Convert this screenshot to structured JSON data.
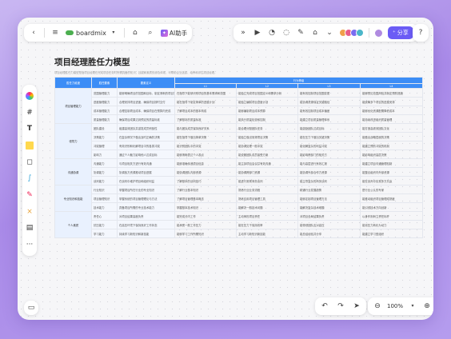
{
  "top_bar": {
    "back_icon": "chevron-left-icon",
    "menu_icon": "menu-icon",
    "app_name": "boardmix",
    "tag_icon": "tag-icon",
    "search_icon": "search-icon",
    "ai_label": "AI助手"
  },
  "toolbar_mid": {
    "icons": [
      "expand-icon",
      "play-icon",
      "timer-icon",
      "comment-icon",
      "vote-icon",
      "library-icon",
      "more-icon"
    ],
    "share_label": "分享"
  },
  "sidebar": {
    "tools": [
      "logo-icon",
      "frame-icon",
      "text-icon",
      "sticky-note-icon",
      "shape-icon",
      "connector-icon",
      "pen-icon",
      "mindmap-icon",
      "template-icon",
      "more-icon"
    ]
  },
  "bottom": {
    "zoom_level": "100%"
  },
  "document": {
    "title": "项目经理胜任力模型",
    "description": "项目经理胜任力模型是指项目经理在完成项目任务时所需具备的知识、技能和素质的综合体现，可帮助企业选拔、培养和评估项目经理。"
  },
  "table": {
    "headers": {
      "group": "胜任力维度",
      "sub": "胜任要素",
      "def": "要素定义",
      "levels_title": "行为等级"
    },
    "levels": [
      "L1",
      "L2",
      "L3",
      "L4"
    ],
    "rows": [
      {
        "group": "项目管理能力",
        "sub": "范围管理能力",
        "def": "能够明确项目的范围和目标，制定清晰的项目范围说明",
        "l": [
          "在指导下能够识别项目的基本需求和范围",
          "能独立完成项目范围定义和需求分析",
          "能有效控制项目范围变更",
          "能够预见范围风险并制定预防措施"
        ]
      },
      {
        "group": "",
        "sub": "进度管理能力",
        "def": "合理安排项目进度，确保项目按时交付",
        "l": [
          "能在指导下制定简单的进度计划",
          "能独立编制项目进度计划",
          "能协调资源保证关键路径",
          "能统筹多个项目的进度安排"
        ]
      },
      {
        "group": "",
        "sub": "成本管理能力",
        "def": "合理控制项目成本，确保项目在预算内完成",
        "l": [
          "了解项目成本的基本构成",
          "能够编制项目成本预算",
          "能有效控制项目成本偏差",
          "能够优化资源配置降低成本"
        ]
      },
      {
        "group": "",
        "sub": "质量管理能力",
        "def": "确保项目成果达到预定的质量标准",
        "l": [
          "了解基本的质量标准",
          "能执行质量检查和控制",
          "能建立项目质量管理体系",
          "能持续改进组织质量管理"
        ]
      },
      {
        "group": "领导力",
        "sub": "团队建设",
        "def": "组建高效团队并激发成员积极性",
        "l": [
          "能与团队成员保持良好关系",
          "能合理分配团队任务",
          "能激励团队达成目标",
          "能打造高绩效团队文化"
        ]
      },
      {
        "group": "",
        "sub": "决策能力",
        "def": "在复杂情况下做出及时正确的决策",
        "l": [
          "能在指导下做出简单决策",
          "能独立做出常规项目决策",
          "能在压力下做出关键决策",
          "能做出战略层面的决策"
        ]
      },
      {
        "group": "",
        "sub": "冲突管理",
        "def": "有效识别和化解项目中的各类冲突",
        "l": [
          "能识别团队中的冲突",
          "能协调处理一般冲突",
          "能化解复杂的利益冲突",
          "能建立预防冲突的机制"
        ]
      },
      {
        "group": "",
        "sub": "影响力",
        "def": "通过个人魅力影响他人达成目标",
        "l": [
          "能够清晰表达个人观点",
          "能说服团队成员接受方案",
          "能影响跨部门的相关方",
          "能影响组织高层决策"
        ]
      },
      {
        "group": "沟通协调",
        "sub": "沟通能力",
        "def": "与项目相关方进行有效沟通",
        "l": [
          "能够准确传递项目信息",
          "能主持项目会议并有效沟通",
          "能与高层进行有效汇报",
          "能建立项目沟通管理机制"
        ]
      },
      {
        "group": "",
        "sub": "协调能力",
        "def": "协调各方资源推动项目进展",
        "l": [
          "能协调团队内部资源",
          "能协调跨部门资源",
          "能协调外部合作方资源",
          "能整合组织内外部资源"
        ]
      },
      {
        "group": "",
        "sub": "谈判能力",
        "def": "在谈判中维护项目和组织利益",
        "l": [
          "了解基本的谈判技巧",
          "能进行常规商务谈判",
          "能主导复杂的商务谈判",
          "能在谈判中实现多方共赢"
        ]
      },
      {
        "group": "专业知识和技能",
        "sub": "行业知识",
        "def": "掌握项目所在行业的专业知识",
        "l": [
          "了解行业基本知识",
          "熟悉行业业务流程",
          "精通行业发展趋势",
          "是行业公认的专家"
        ]
      },
      {
        "group": "",
        "sub": "项目管理知识",
        "def": "掌握系统的项目管理理论与方法",
        "l": [
          "了解项目管理基本概念",
          "熟练应用项目管理工具",
          "能够定制项目管理方法",
          "能推动组织项目管理成熟度"
        ]
      },
      {
        "group": "",
        "sub": "技术能力",
        "def": "具备项目所需的专业技术能力",
        "l": [
          "掌握基本技术知识",
          "能解决一般技术问题",
          "能解决复杂技术难题",
          "能引领技术方向创新"
        ]
      },
      {
        "group": "个人素质",
        "sub": "责任心",
        "def": "对项目结果高度负责",
        "l": [
          "能完成分内工作",
          "主动承担项目责任",
          "对项目全局结果负责",
          "以身作则树立责任标杆"
        ]
      },
      {
        "group": "",
        "sub": "抗压能力",
        "def": "在高压环境下保持良好工作状态",
        "l": [
          "能承受一般工作压力",
          "能在压力下保持效率",
          "能带领团队应对高压",
          "能将压力转化为动力"
        ]
      },
      {
        "group": "",
        "sub": "学习能力",
        "def": "持续学习新知识和新技能",
        "l": [
          "能够学习工作所需知识",
          "主动学习新知识新技能",
          "能总结经验并分享",
          "能建立学习型组织"
        ]
      }
    ]
  },
  "colors": {
    "header_blue": "#3c8df6",
    "accent_purple": "#6b5cf5",
    "group_bg": "#e9f1fe"
  }
}
